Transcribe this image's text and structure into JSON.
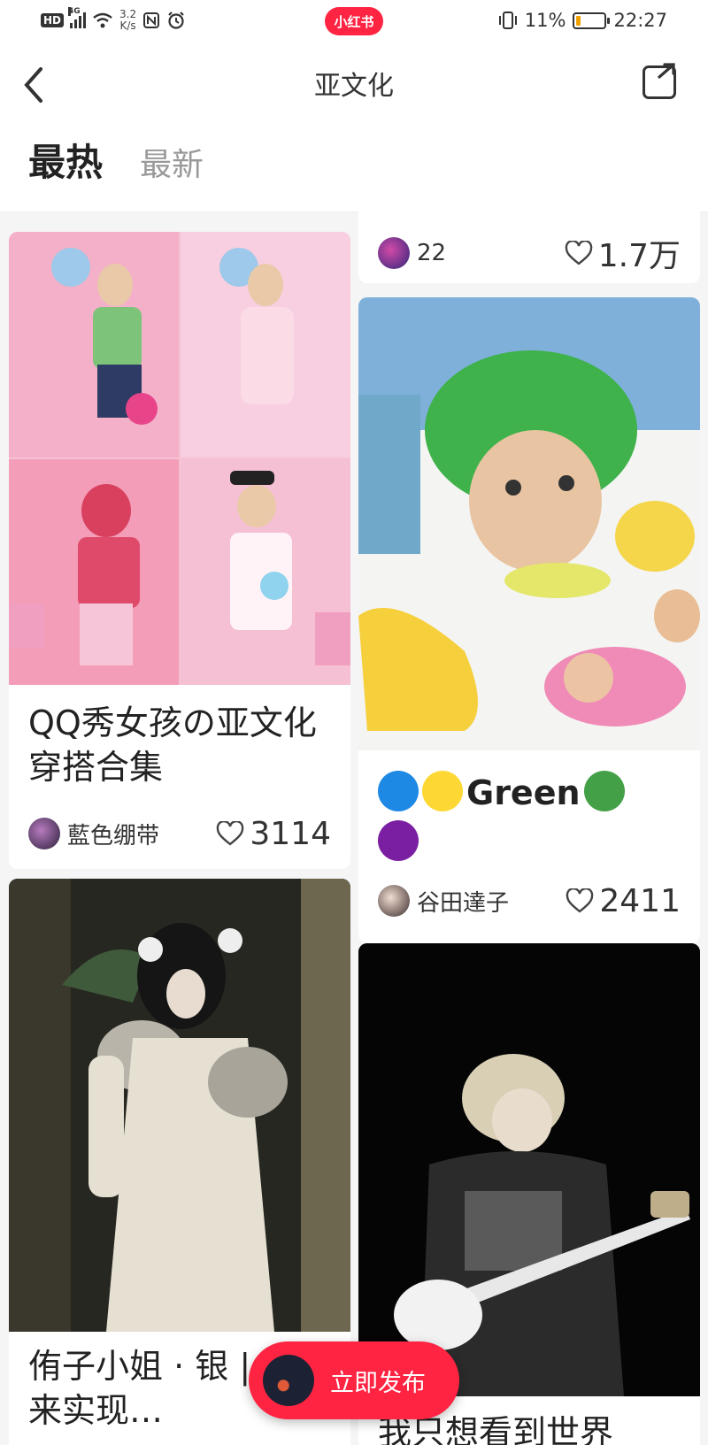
{
  "status_bar": {
    "hd": "HD",
    "network": "4G",
    "speed_value": "3.2",
    "speed_unit": "K/s",
    "app_badge": "小红书",
    "battery_pct": "11%",
    "battery_fill": 0.11,
    "time": "22:27"
  },
  "header": {
    "title": "亚文化",
    "back_icon": "chevron-left-icon",
    "share_icon": "share-icon"
  },
  "tabs": [
    {
      "label": "最热",
      "active": true
    },
    {
      "label": "最新",
      "active": false
    }
  ],
  "feed": {
    "left": [
      {
        "title": "QQ秀女孩の亚文化穿搭合集",
        "author": "藍色绷带",
        "likes": "3114"
      },
      {
        "title": "侑子小姐 · 银 | 让我来实现…"
      }
    ],
    "right": [
      {
        "author_count": "22",
        "likes": "1.7万"
      },
      {
        "title_text": "Green",
        "author": "谷田達子",
        "likes": "2411"
      },
      {
        "title": "我只想看到世界"
      }
    ]
  },
  "publish": {
    "label": "立即发布"
  },
  "colors": {
    "brand": "#ff2442",
    "blue": "#1e88e5",
    "yellow": "#fdd835",
    "green": "#43a047",
    "purple": "#7b1fa2"
  }
}
